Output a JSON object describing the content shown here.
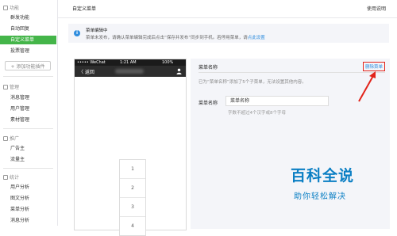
{
  "sidebar": {
    "section_function": "功能",
    "function_items": [
      {
        "label": "群发功能"
      },
      {
        "label": "自动回复"
      },
      {
        "label": "自定义菜单"
      },
      {
        "label": "投票管理"
      }
    ],
    "add_plugin_label": "+ 添加功能插件",
    "section_manage": "管理",
    "manage_items": [
      {
        "label": "消息管理"
      },
      {
        "label": "用户管理"
      },
      {
        "label": "素材管理"
      }
    ],
    "section_promo": "推广",
    "promo_items": [
      {
        "label": "广告主"
      },
      {
        "label": "流量主"
      }
    ],
    "section_stats": "统计",
    "stats_items": [
      {
        "label": "用户分析"
      },
      {
        "label": "图文分析"
      },
      {
        "label": "菜单分析"
      },
      {
        "label": "消息分析"
      }
    ]
  },
  "topbar": {
    "title": "自定义菜单",
    "help": "使用说明"
  },
  "notice": {
    "title": "菜单编辑中",
    "body": "菜单未发布，请确认菜单编辑完成后点击“保存并发布”同步到手机。若停用菜单，请",
    "link": "点此设置"
  },
  "phone": {
    "carrier": "••••• WeChat",
    "time": "1:21 AM",
    "battery": "100%",
    "back_label": "〈 返回",
    "submenu_items": [
      "1",
      "2",
      "3",
      "4"
    ]
  },
  "panel": {
    "header": "菜单名称",
    "delete_label": "删除菜单",
    "note": "已为“菜单名称”添加了5个子菜单，无法设置其他内容。",
    "name_label": "菜单名称",
    "name_value": "菜单名称",
    "hint": "字数不超过4个汉字或8个字母"
  },
  "watermark": {
    "title": "百科全说",
    "subtitle": "助你轻松解决"
  },
  "colors": {
    "accent_green": "#44b549",
    "link_blue": "#2f8dde",
    "highlight_red": "#e2231a"
  }
}
